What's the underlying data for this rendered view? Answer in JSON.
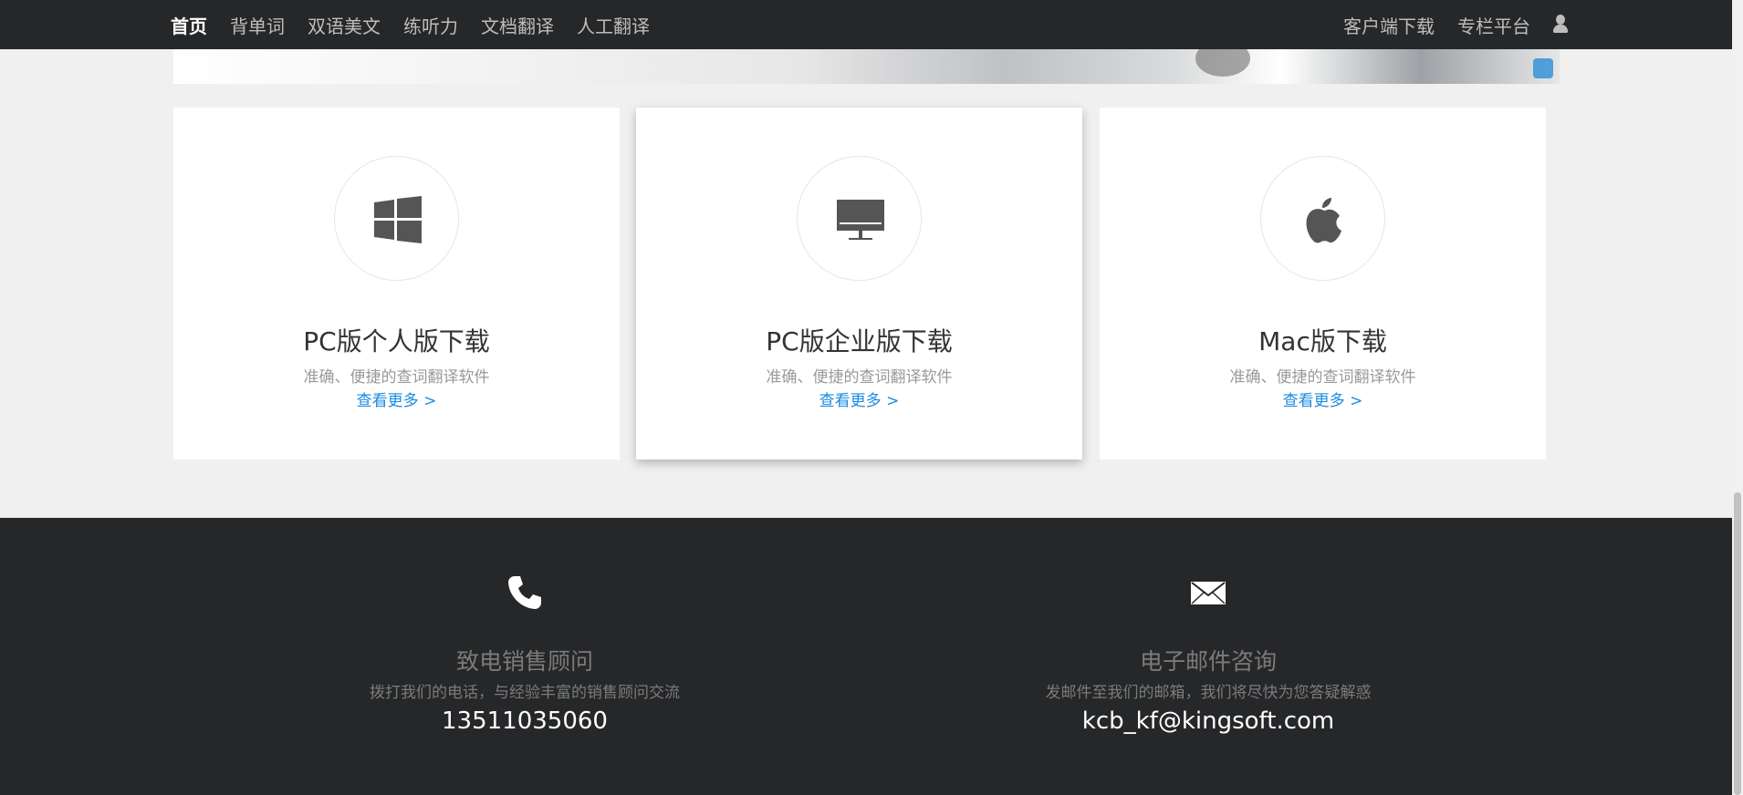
{
  "nav": {
    "left_items": [
      "首页",
      "背单词",
      "双语美文",
      "练听力",
      "文档翻译",
      "人工翻译"
    ],
    "right_items": [
      "客户端下载",
      "专栏平台"
    ],
    "user_icon": "user-icon"
  },
  "cards": [
    {
      "icon": "windows-icon",
      "title": "PC版个人版下载",
      "desc": "准确、便捷的查词翻译软件",
      "more": "查看更多 >"
    },
    {
      "icon": "monitor-icon",
      "title": "PC版企业版下载",
      "desc": "准确、便捷的查词翻译软件",
      "more": "查看更多 >"
    },
    {
      "icon": "apple-icon",
      "title": "Mac版下载",
      "desc": "准确、便捷的查词翻译软件",
      "more": "查看更多 >"
    }
  ],
  "footer": {
    "phone": {
      "icon": "phone-icon",
      "title": "致电销售顾问",
      "desc": "拨打我们的电话，与经验丰富的销售顾问交流",
      "value": "13511035060"
    },
    "mail": {
      "icon": "envelope-icon",
      "title": "电子邮件咨询",
      "desc": "发邮件至我们的邮箱，我们将尽快为您答疑解惑",
      "value": "kcb_kf@kingsoft.com"
    }
  },
  "colors": {
    "nav_bg": "#262729",
    "link": "#1a8be0",
    "page_bg": "#f0f0f0"
  }
}
